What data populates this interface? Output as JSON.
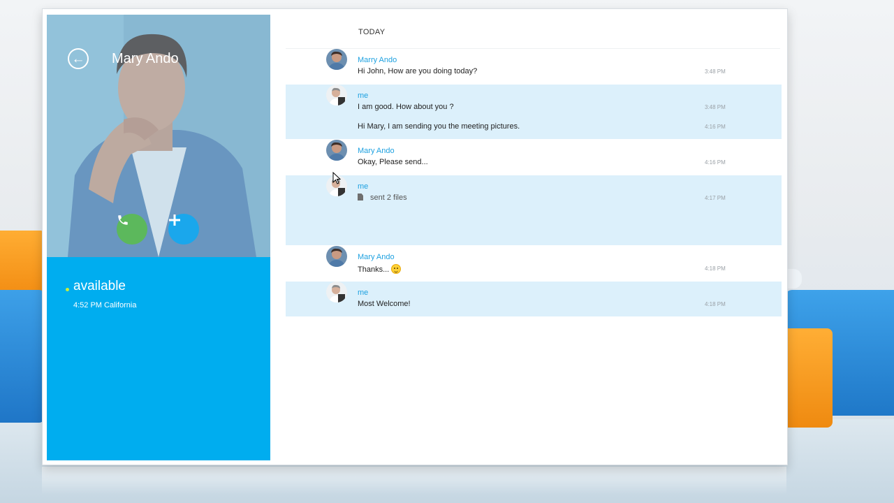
{
  "contact": {
    "name": "Mary Ando",
    "status": "available",
    "local_time": "4:52 PM California"
  },
  "chat": {
    "day_label": "TODAY",
    "messages": [
      {
        "sender": "Marry Ando",
        "text": "Hi John, How are you doing today?",
        "time": "3:48 PM",
        "mine": false
      },
      {
        "sender": "me",
        "text": "I am good. How about you ?",
        "time": "3:48 PM",
        "mine": true
      },
      {
        "sender": "",
        "text": "Hi Mary, I am sending you the meeting pictures.",
        "time": "4:16 PM",
        "mine": true
      },
      {
        "sender": "Mary Ando",
        "text": "Okay, Please send...",
        "time": "4:16 PM",
        "mine": false
      },
      {
        "sender": "me",
        "text": "sent 2 files",
        "time": "4:17 PM",
        "mine": true
      },
      {
        "sender": "Mary Ando",
        "text": "Thanks...",
        "time": "4:18 PM",
        "mine": false
      },
      {
        "sender": "me",
        "text": "Most Welcome!",
        "time": "4:18 PM",
        "mine": true
      }
    ]
  },
  "icons": {
    "back": "back-arrow-icon",
    "call": "phone-icon",
    "add": "plus-icon",
    "file": "file-icon",
    "emoji": "smiley-emoji-icon"
  },
  "colors": {
    "accent": "#00adef",
    "call_button": "#5cb85c",
    "add_button": "#1aa7ec",
    "status_dot": "#c8ef3a",
    "my_message_bg": "#dcf0fb",
    "sender_name": "#1ea1e0"
  }
}
